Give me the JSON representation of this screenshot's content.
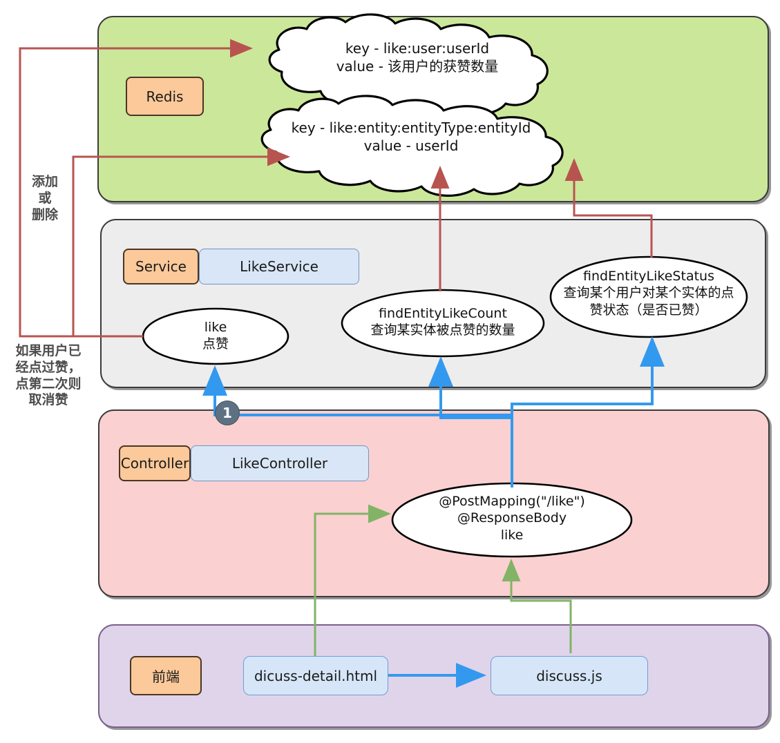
{
  "diagram": {
    "title": "Like feature architecture (Redis / Service / Controller / Frontend)",
    "colors": {
      "redis_layer": "#cbe79a",
      "service_layer": "#ededed",
      "controller_layer": "#fad0d0",
      "frontend_layer": "#e0d4ea",
      "lane_badge": "#fbc99a",
      "class_box": "#d9e6f7",
      "arrow_red": "#b85450",
      "arrow_blue": "#3399ee",
      "arrow_green": "#82b366",
      "step_badge": "#5d7183"
    }
  },
  "layers": {
    "redis": {
      "lane_label": "Redis",
      "clouds": [
        {
          "line1": "key - like:user:userId",
          "line2": "value - 该用户的获赞数量"
        },
        {
          "line1": "key - like:entity:entityType:entityId",
          "line2": "value - userId"
        }
      ]
    },
    "service": {
      "lane_label": "Service",
      "class_name": "LikeService",
      "methods": [
        {
          "name": "like",
          "desc": "点赞"
        },
        {
          "name": "findEntityLikeCount",
          "desc": "查询某实体被点赞的数量"
        },
        {
          "name": "findEntityLikeStatus",
          "desc_line1": "查询某个用户对某个实体的点",
          "desc_line2": "赞状态（是否已赞）"
        }
      ]
    },
    "controller": {
      "lane_label": "Controller",
      "class_name": "LikeController",
      "endpoint": {
        "line1": "@PostMapping(\"/like\")",
        "line2": "@ResponseBody",
        "line3": "like"
      }
    },
    "frontend": {
      "lane_label": "前端",
      "files": [
        {
          "name": "dicuss-detail.html"
        },
        {
          "name": "discuss.js"
        }
      ]
    }
  },
  "annotations": {
    "add_or_delete": [
      "添加",
      "或",
      "删除"
    ],
    "already_liked": [
      "如果用户已",
      "经点过赞，",
      "点第二次则",
      "取消赞"
    ],
    "step_one": "1"
  }
}
